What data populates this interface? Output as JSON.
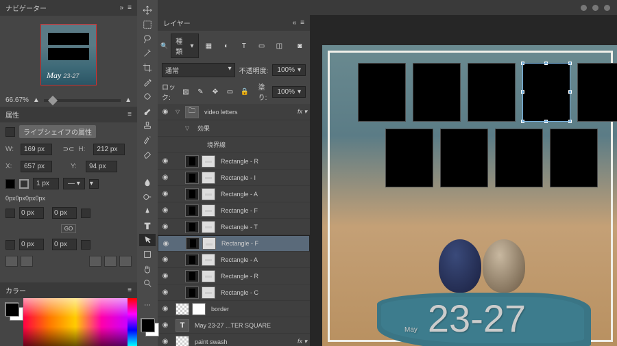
{
  "navigator": {
    "title": "ナビゲーター",
    "zoom": "66.67%"
  },
  "properties": {
    "title": "属性",
    "shape_label": "ライブシェイフの属性",
    "w_label": "W:",
    "w_val": "169 px",
    "h_label": "H:",
    "h_val": "212 px",
    "x_label": "X:",
    "x_val": "657 px",
    "y_label": "Y:",
    "y_val": "94 px",
    "stroke_val": "1 px",
    "corners": "0px0px0px0px",
    "corner_val": "0 px",
    "link_icon": "GO"
  },
  "color": {
    "title": "カラー"
  },
  "layers": {
    "title": "レイヤー",
    "search_label": "種類",
    "blend_mode": "通常",
    "opacity_label": "不透明度:",
    "opacity_val": "100%",
    "lock_label": "ロック:",
    "fill_label": "塗り:",
    "fill_val": "100%",
    "items": [
      {
        "name": "video letters",
        "kind": "group",
        "indent": 0,
        "fx": true,
        "expanded": true
      },
      {
        "name": "効果",
        "kind": "fxline",
        "indent": 1
      },
      {
        "name": "境界線",
        "kind": "fxline",
        "indent": 2
      },
      {
        "name": "Rectangle - R",
        "kind": "rect",
        "indent": 1
      },
      {
        "name": "Rectangle - I",
        "kind": "rect",
        "indent": 1
      },
      {
        "name": "Rectangle - A",
        "kind": "rect",
        "indent": 1
      },
      {
        "name": "Rectangle - F",
        "kind": "rect",
        "indent": 1
      },
      {
        "name": "Rectangle - T",
        "kind": "rect",
        "indent": 1
      },
      {
        "name": "Rectangle - F",
        "kind": "rect",
        "indent": 1,
        "selected": true
      },
      {
        "name": "Rectangle - A",
        "kind": "rect",
        "indent": 1
      },
      {
        "name": "Rectangle - R",
        "kind": "rect",
        "indent": 1
      },
      {
        "name": "Rectangle - C",
        "kind": "rect",
        "indent": 1
      },
      {
        "name": "border",
        "kind": "bitmap",
        "indent": 0,
        "mask": true
      },
      {
        "name": "May 23-27 ...TER SQUARE",
        "kind": "text",
        "indent": 0
      },
      {
        "name": "paint swash",
        "kind": "bitmap",
        "indent": 0,
        "fx": true
      }
    ]
  },
  "canvas": {
    "may_text": "May",
    "may_dates": "23-27"
  }
}
